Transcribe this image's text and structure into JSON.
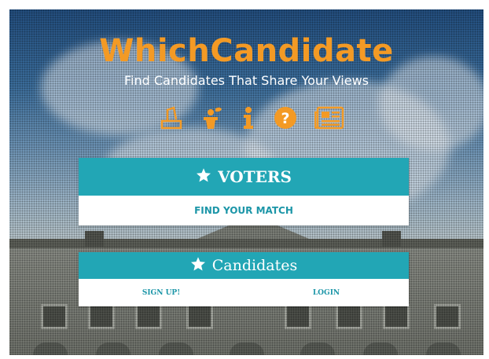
{
  "header": {
    "title": "WhichCandidate",
    "tagline": "Find Candidates That Share Your Views"
  },
  "nav_icons": [
    "ballot-box-icon",
    "speaker-podium-icon",
    "info-icon",
    "help-icon",
    "news-icon"
  ],
  "voters": {
    "heading": "VOTERS",
    "action_label": "FIND YOUR MATCH"
  },
  "candidates": {
    "heading": "Candidates",
    "signup_label": "SIGN UP!",
    "login_label": "LOGIN"
  },
  "colors": {
    "brand_orange": "#f39a25",
    "accent_teal": "#22a6b5",
    "link_teal": "#1c96a8"
  }
}
